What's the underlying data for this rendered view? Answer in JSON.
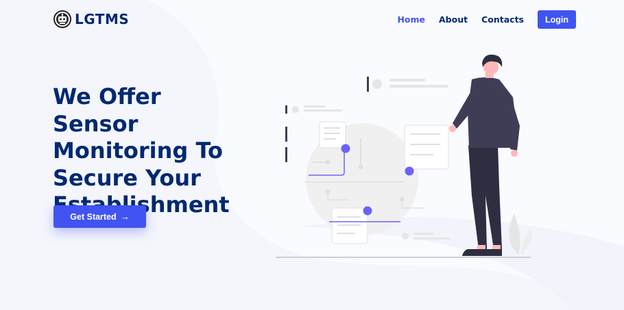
{
  "brand": {
    "name": "LGTMS",
    "logo_icon": "robot-badge-icon"
  },
  "nav": {
    "items": [
      {
        "label": "Home",
        "active": true
      },
      {
        "label": "About",
        "active": false
      },
      {
        "label": "Contacts",
        "active": false
      }
    ],
    "login_label": "Login"
  },
  "hero": {
    "title": "We Offer Sensor Monitoring To Secure Your Establishment",
    "cta_label": "Get Started",
    "cta_icon": "arrow-right-icon"
  },
  "illustration": {
    "icon": "person-with-sensor-nodes-illustration"
  },
  "colors": {
    "primary": "#4154f1",
    "heading": "#012970",
    "background": "#f4f6fc",
    "accent_node": "#6c63ff"
  }
}
